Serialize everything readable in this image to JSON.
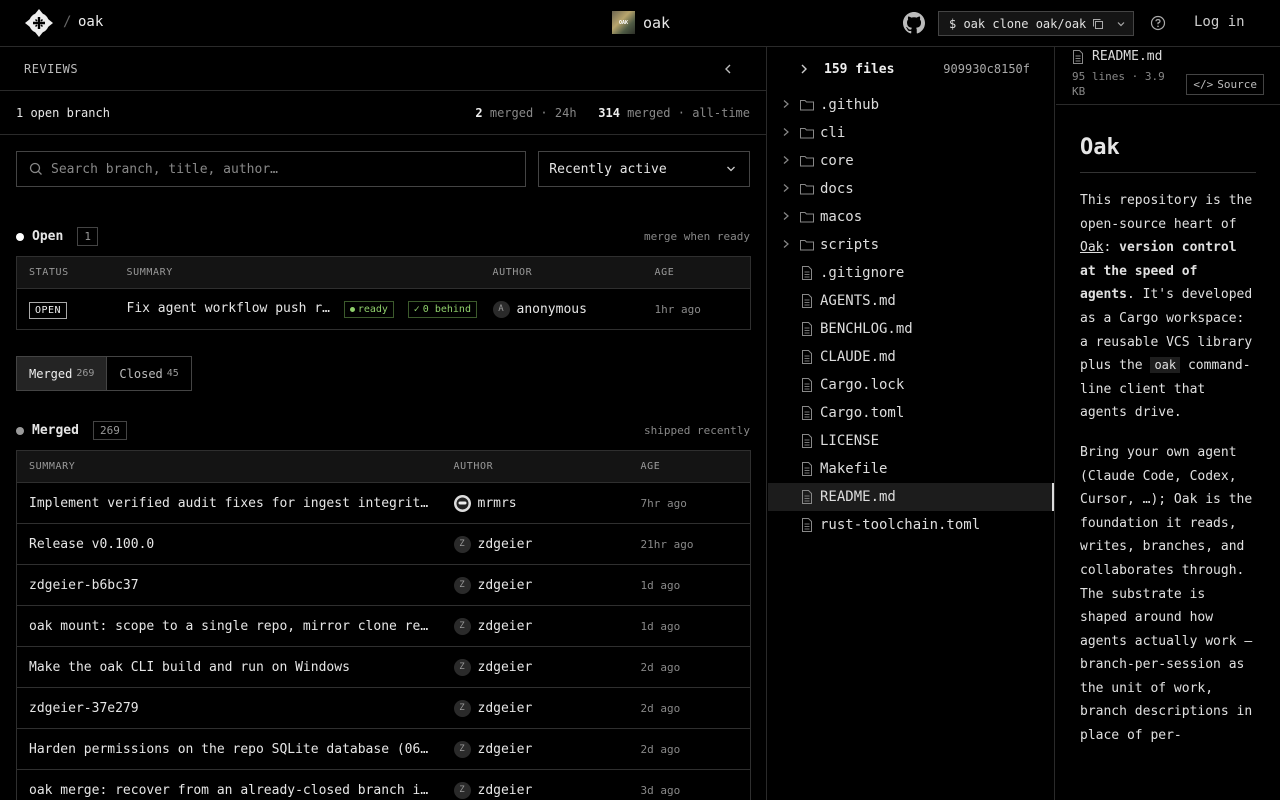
{
  "header": {
    "breadcrumb": "oak",
    "repo_title": "oak",
    "repo_thumb_text": "OAK",
    "clone_command": "$ oak clone oak/oak",
    "login_label": "Log in"
  },
  "reviews": {
    "title": "REVIEWS",
    "open_branches": "1 open branch",
    "merged_24h_count": "2",
    "merged_24h_label": "merged · 24h",
    "merged_all_count": "314",
    "merged_all_label": "merged · all-time",
    "search_placeholder": "Search branch, title, author…",
    "sort_value": "Recently active"
  },
  "open_section": {
    "title": "Open",
    "count": "1",
    "note": "merge when ready",
    "columns": [
      "STATUS",
      "SUMMARY",
      "AUTHOR",
      "AGE"
    ],
    "rows": [
      {
        "status": "OPEN",
        "summary": "Fix agent workflow push r…",
        "pill_ready": "ready",
        "pill_behind": "0 behind",
        "avatar": "A",
        "author": "anonymous",
        "age": "1hr ago"
      }
    ]
  },
  "tabs": [
    {
      "label": "Merged",
      "count": "269"
    },
    {
      "label": "Closed",
      "count": "45"
    }
  ],
  "merged_section": {
    "title": "Merged",
    "count": "269",
    "note": "shipped recently",
    "columns": [
      "SUMMARY",
      "AUTHOR",
      "AGE"
    ],
    "rows": [
      {
        "summary": "Implement verified audit fixes for ingest integrity…",
        "avatar": "",
        "author": "mrmrs",
        "age": "7hr ago"
      },
      {
        "summary": "Release v0.100.0",
        "avatar": "Z",
        "author": "zdgeier",
        "age": "21hr ago"
      },
      {
        "summary": "zdgeier-b6bc37",
        "avatar": "Z",
        "author": "zdgeier",
        "age": "1d ago"
      },
      {
        "summary": "oak mount: scope to a single repo, mirror clone res…",
        "avatar": "Z",
        "author": "zdgeier",
        "age": "1d ago"
      },
      {
        "summary": "Make the oak CLI build and run on Windows",
        "avatar": "Z",
        "author": "zdgeier",
        "age": "2d ago"
      },
      {
        "summary": "zdgeier-37e279",
        "avatar": "Z",
        "author": "zdgeier",
        "age": "2d ago"
      },
      {
        "summary": "Harden permissions on the repo SQLite database (060…",
        "avatar": "Z",
        "author": "zdgeier",
        "age": "2d ago"
      },
      {
        "summary": "oak merge: recover from an already-closed branch in…",
        "avatar": "Z",
        "author": "zdgeier",
        "age": "3d ago"
      }
    ]
  },
  "files": {
    "count_label": "159 files",
    "commit": "909930c8150f",
    "items": [
      {
        "name": ".github",
        "type": "folder"
      },
      {
        "name": "cli",
        "type": "folder"
      },
      {
        "name": "core",
        "type": "folder"
      },
      {
        "name": "docs",
        "type": "folder"
      },
      {
        "name": "macos",
        "type": "folder"
      },
      {
        "name": "scripts",
        "type": "folder"
      },
      {
        "name": ".gitignore",
        "type": "file"
      },
      {
        "name": "AGENTS.md",
        "type": "file"
      },
      {
        "name": "BENCHLOG.md",
        "type": "file"
      },
      {
        "name": "CLAUDE.md",
        "type": "file"
      },
      {
        "name": "Cargo.lock",
        "type": "file"
      },
      {
        "name": "Cargo.toml",
        "type": "file"
      },
      {
        "name": "LICENSE",
        "type": "file"
      },
      {
        "name": "Makefile",
        "type": "file"
      },
      {
        "name": "README.md",
        "type": "file",
        "selected": true
      },
      {
        "name": "rust-toolchain.toml",
        "type": "file"
      }
    ]
  },
  "readme": {
    "filename": "README.md",
    "meta": "95 lines · 3.9 KB",
    "source_label": "Source",
    "heading": "Oak",
    "p1_a": "This repository is the open-source heart of ",
    "p1_link": "Oak",
    "p1_b": ": ",
    "p1_bold": "version control at the speed of agents",
    "p1_c": ". It's developed as a Cargo workspace: a reusable VCS library plus the ",
    "p1_code": "oak",
    "p1_d": " command-line client that agents drive.",
    "p2": "Bring your own agent (Claude Code, Codex, Cursor, …); Oak is the foundation it reads, writes, branches, and collaborates through. The substrate is shaped around how agents actually work — branch-per-session as the unit of work, branch descriptions in place of per-"
  },
  "colors": {
    "open_dot": "#ffffff",
    "merged_dot": "#9a9a9a",
    "ready": "#8fcf6b"
  },
  "icons": [
    "logo-icon",
    "github-icon",
    "copy-icon",
    "chevron-down-icon",
    "help-icon",
    "chevron-left-icon",
    "chevron-right-icon",
    "search-icon",
    "folder-icon",
    "file-icon",
    "code-icon",
    "check-icon"
  ]
}
